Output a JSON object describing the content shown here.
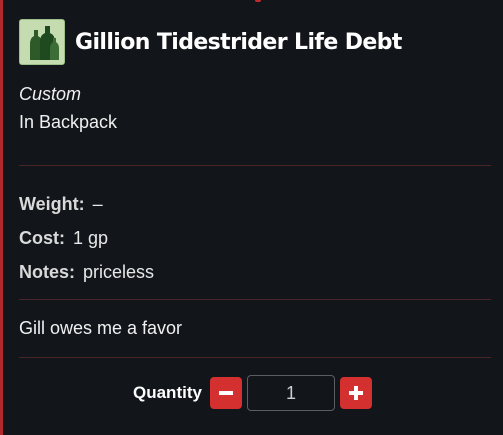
{
  "item": {
    "name": "Gillion Tidestrider Life Debt",
    "icon": "green-bottles-icon",
    "subtype": "Custom",
    "location": "In Backpack"
  },
  "properties": {
    "weight_label": "Weight:",
    "weight_value": "–",
    "cost_label": "Cost:",
    "cost_value": "1 gp",
    "notes_label": "Notes:",
    "notes_value": "priceless"
  },
  "description": "Gill owes me a favor",
  "quantity": {
    "label": "Quantity",
    "value": "1",
    "decrement_icon": "minus-icon",
    "increment_icon": "plus-icon"
  },
  "colors": {
    "background": "#12161b",
    "accent": "#b3282d",
    "button": "#d4302f",
    "divider": "#4a2528"
  }
}
